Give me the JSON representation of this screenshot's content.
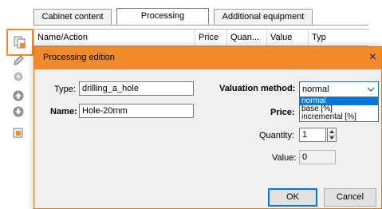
{
  "tabs": [
    {
      "label": "Cabinet content"
    },
    {
      "label": "Processing"
    },
    {
      "label": "Additional equipment"
    }
  ],
  "grid": {
    "columns": [
      "Name/Action",
      "Price",
      "Quan...",
      "Value",
      "Typ"
    ]
  },
  "dialog": {
    "title": "Processing edition",
    "close_glyph": "×",
    "type_label": "Type:",
    "type_value": "drilling_a_hole",
    "name_label": "Name:",
    "name_value": "Hole-20mm",
    "valuation_label": "Valuation method:",
    "valuation_selected": "normal",
    "valuation_options": [
      "normal",
      "base [%]",
      "incremental [%]"
    ],
    "price_label": "Price:",
    "quantity_label": "Quantity:",
    "quantity_value": "1",
    "value_label": "Value:",
    "value_value": "0",
    "ok_label": "OK",
    "cancel_label": "Cancel"
  },
  "toolbar": {
    "icons": [
      "copy-icon",
      "edit-icon",
      "wrench-icon",
      "move-up-icon",
      "move-down-icon",
      "tool-folder-icon"
    ]
  },
  "colors": {
    "titlebar": "#f08a2a",
    "highlight": "#f08a2a",
    "focus": "#0078d7"
  }
}
